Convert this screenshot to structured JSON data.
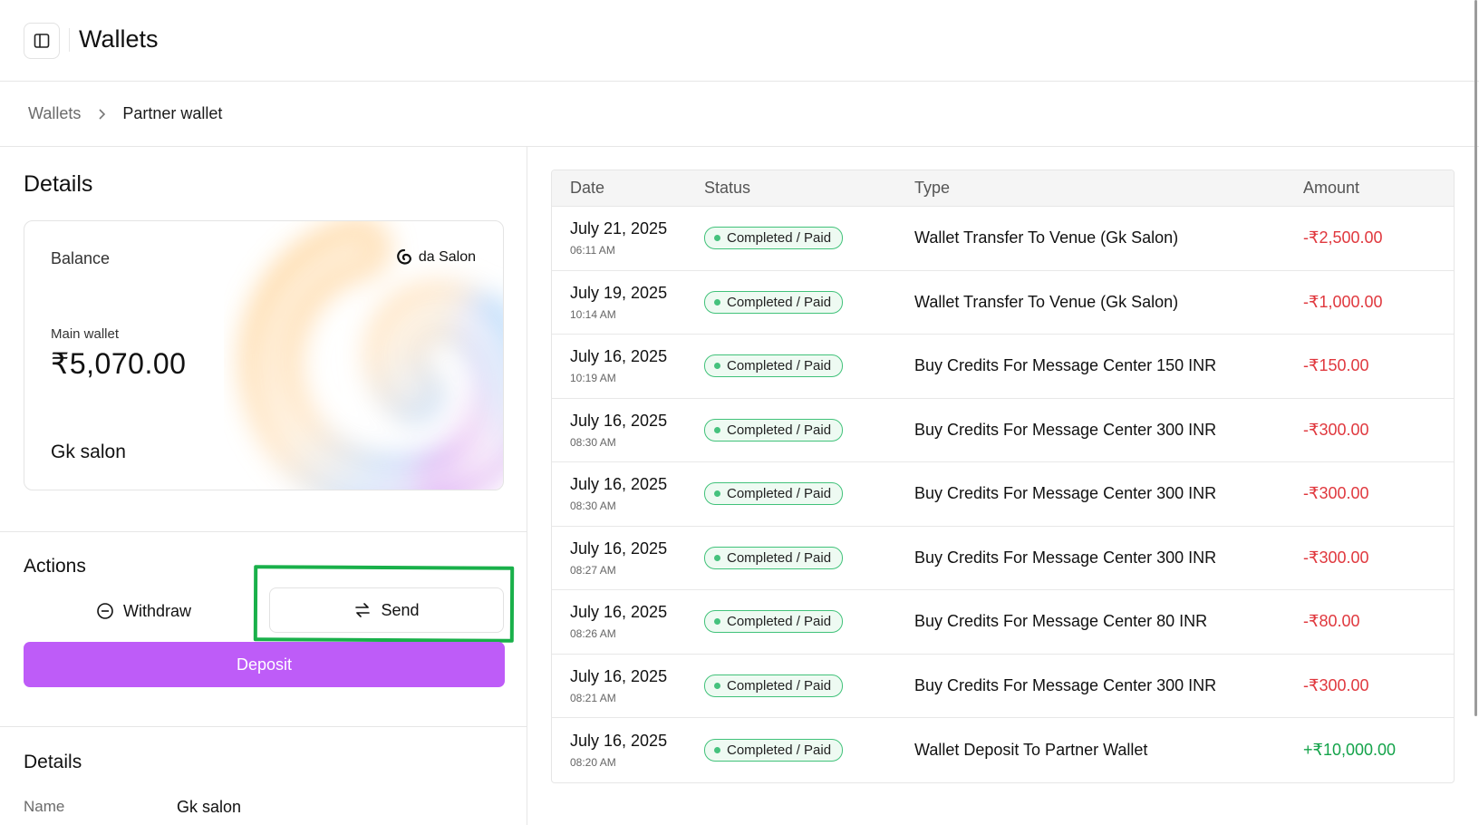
{
  "header": {
    "title": "Wallets",
    "toggle_icon": "sidebar-panel-icon"
  },
  "breadcrumb": {
    "parent": "Wallets",
    "current": "Partner wallet"
  },
  "details": {
    "title": "Details",
    "card": {
      "balance_label": "Balance",
      "brand": "da Salon",
      "wallet_label": "Main wallet",
      "amount": "₹5,070.00",
      "owner": "Gk salon"
    }
  },
  "actions": {
    "title": "Actions",
    "withdraw_label": "Withdraw",
    "send_label": "Send",
    "deposit_label": "Deposit"
  },
  "details_section": {
    "title": "Details",
    "name_label": "Name",
    "name_value": "Gk salon"
  },
  "table": {
    "headers": {
      "date": "Date",
      "status": "Status",
      "type": "Type",
      "amount": "Amount"
    },
    "rows": [
      {
        "date": "July 21, 2025",
        "time": "06:11 AM",
        "status": "Completed / Paid",
        "type": "Wallet Transfer To Venue (Gk Salon)",
        "amount": "-₹2,500.00",
        "sign": "neg"
      },
      {
        "date": "July 19, 2025",
        "time": "10:14 AM",
        "status": "Completed / Paid",
        "type": "Wallet Transfer To Venue (Gk Salon)",
        "amount": "-₹1,000.00",
        "sign": "neg"
      },
      {
        "date": "July 16, 2025",
        "time": "10:19 AM",
        "status": "Completed / Paid",
        "type": "Buy Credits For Message Center 150 INR",
        "amount": "-₹150.00",
        "sign": "neg"
      },
      {
        "date": "July 16, 2025",
        "time": "08:30 AM",
        "status": "Completed / Paid",
        "type": "Buy Credits For Message Center 300 INR",
        "amount": "-₹300.00",
        "sign": "neg"
      },
      {
        "date": "July 16, 2025",
        "time": "08:30 AM",
        "status": "Completed / Paid",
        "type": "Buy Credits For Message Center 300 INR",
        "amount": "-₹300.00",
        "sign": "neg"
      },
      {
        "date": "July 16, 2025",
        "time": "08:27 AM",
        "status": "Completed / Paid",
        "type": "Buy Credits For Message Center 300 INR",
        "amount": "-₹300.00",
        "sign": "neg"
      },
      {
        "date": "July 16, 2025",
        "time": "08:26 AM",
        "status": "Completed / Paid",
        "type": "Buy Credits For Message Center 80 INR",
        "amount": "-₹80.00",
        "sign": "neg"
      },
      {
        "date": "July 16, 2025",
        "time": "08:21 AM",
        "status": "Completed / Paid",
        "type": "Buy Credits For Message Center 300 INR",
        "amount": "-₹300.00",
        "sign": "neg"
      },
      {
        "date": "July 16, 2025",
        "time": "08:20 AM",
        "status": "Completed / Paid",
        "type": "Wallet Deposit To Partner Wallet",
        "amount": "+₹10,000.00",
        "sign": "pos"
      }
    ]
  },
  "colors": {
    "accent": "#be5cf8",
    "negative": "#e0383e",
    "positive": "#14a34a",
    "status_border": "#41c27a",
    "highlight": "#19b04a"
  }
}
